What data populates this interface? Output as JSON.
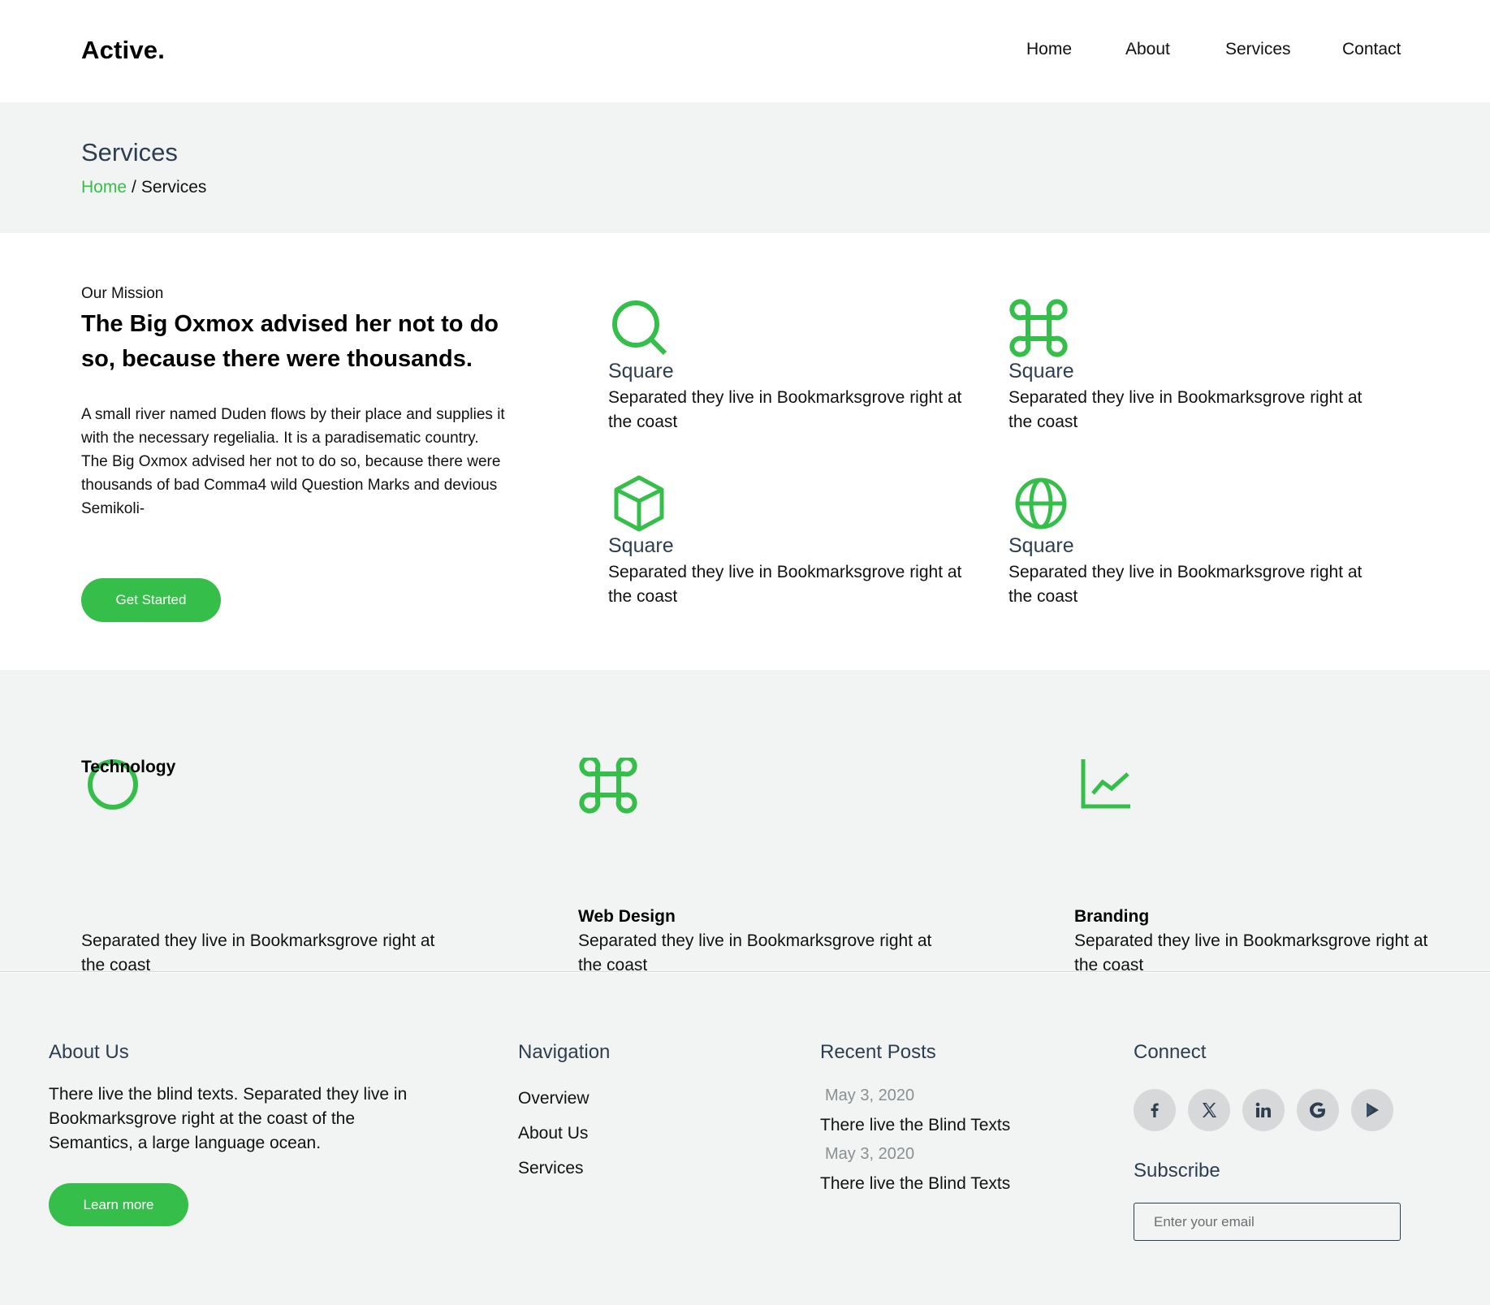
{
  "brand": {
    "logo": "Active."
  },
  "nav": {
    "items": [
      "Home",
      "About",
      "Services",
      "Contact"
    ]
  },
  "page": {
    "title": "Services",
    "breadcrumb_home": "Home",
    "breadcrumb_sep": "/",
    "breadcrumb_current": "Services"
  },
  "mission": {
    "eyebrow": "Our Mission",
    "headline": "The Big Oxmox advised her not to do so, because there were thousands.",
    "paragraph1": "A small river named Duden flows by their place and supplies it with the necessary regelialia. It is a paradisematic country.",
    "paragraph2": "The Big Oxmox advised her not to do so, because there were thousands of bad Comma4 wild Question Marks and devious Semikoli-",
    "button": "Get Started"
  },
  "features": [
    {
      "icon": "search-icon",
      "title": "Square",
      "text": "Separated they live in Bookmarksgrove right at the coast"
    },
    {
      "icon": "command-icon",
      "title": "Square",
      "text": "Separated they live in Bookmarksgrove right at the coast"
    },
    {
      "icon": "box-icon",
      "title": "Square",
      "text": "Separated they live in Bookmarksgrove right at the coast"
    },
    {
      "icon": "globe-icon",
      "title": "Square",
      "text": "Separated they live in Bookmarksgrove right at the coast"
    }
  ],
  "services": [
    {
      "icon": "circle-icon",
      "title": "Technology",
      "text": "Separated they live in Bookmarksgrove right at the coast"
    },
    {
      "icon": "command-icon",
      "title": "Web Design",
      "text": "Separated they live in Bookmarksgrove right at the coast"
    },
    {
      "icon": "chart-line-icon",
      "title": "Branding",
      "text": "Separated they live in Bookmarksgrove right at the coast"
    }
  ],
  "footer": {
    "about": {
      "title": "About Us",
      "text": "There live the blind texts. Separated they live in Bookmarksgrove right at the coast of the Semantics, a large language ocean.",
      "button": "Learn more"
    },
    "navigation": {
      "title": "Navigation",
      "items": [
        "Overview",
        "About Us",
        "Services"
      ]
    },
    "recent_posts": {
      "title": "Recent Posts",
      "posts": [
        {
          "date": "May 3, 2020",
          "title": "There live the Blind Texts"
        },
        {
          "date": "May 3, 2020",
          "title": "There live the Blind Texts"
        }
      ]
    },
    "connect": {
      "title": "Connect",
      "icons": [
        "facebook-icon",
        "x-twitter-icon",
        "linkedin-icon",
        "google-icon",
        "play-icon"
      ]
    },
    "subscribe": {
      "title": "Subscribe",
      "placeholder": "Enter your email"
    }
  },
  "colors": {
    "accent": "#35bf4a",
    "heading": "#2d3e50",
    "band": "#f2f4f3",
    "muted": "#8a8f93"
  }
}
